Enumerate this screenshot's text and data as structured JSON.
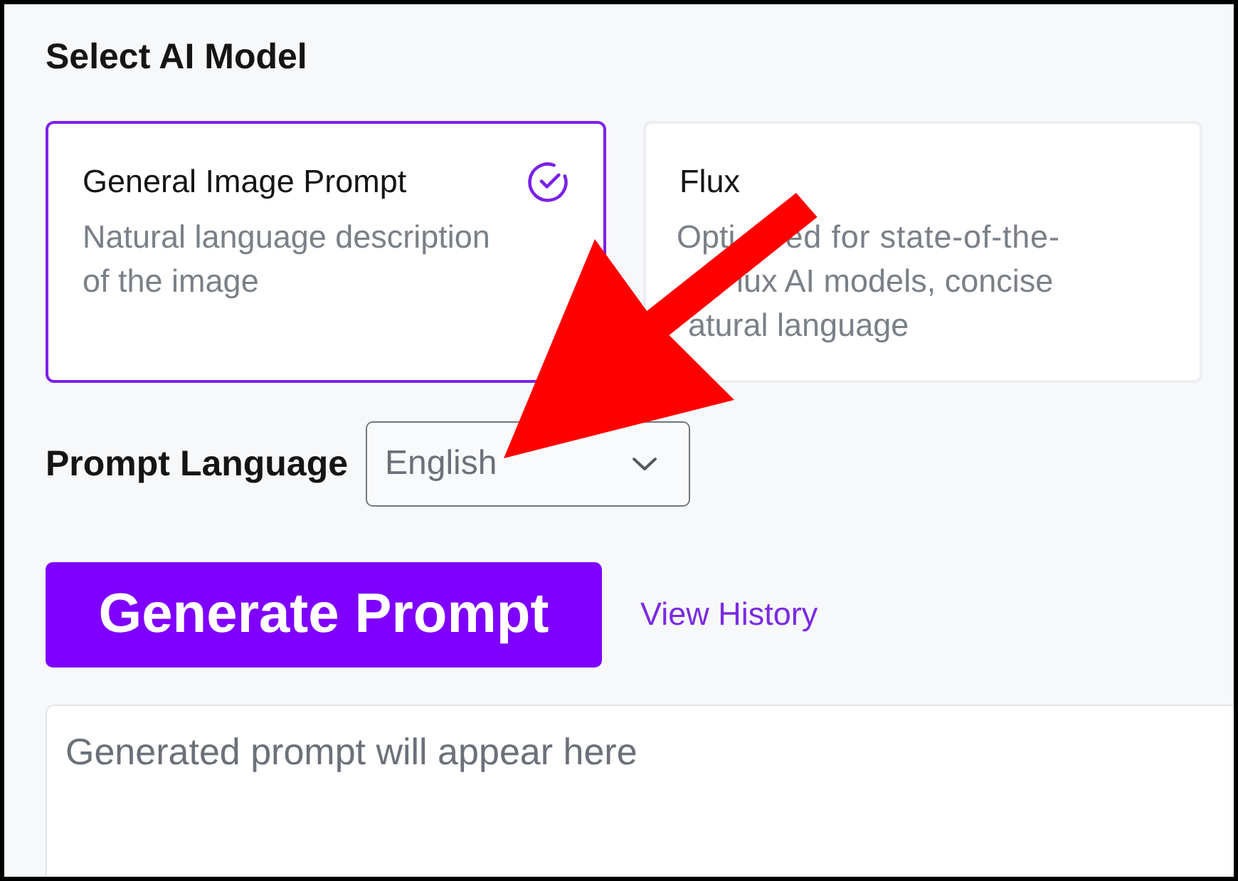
{
  "heading": "Select AI Model",
  "models": [
    {
      "title": "General Image Prompt",
      "description": "Natural language description of the image",
      "selected": true
    },
    {
      "title": "Flux",
      "description_lines": [
        [
          "Opti",
          "ed for state-of-the-"
        ],
        [
          "lux AI models, concise"
        ],
        [
          "atural language"
        ]
      ],
      "selected": false
    }
  ],
  "language": {
    "label": "Prompt Language",
    "value": "English"
  },
  "generate_button": "Generate Prompt",
  "history_link": "View History",
  "output": {
    "placeholder": "Generated prompt will appear here"
  }
}
